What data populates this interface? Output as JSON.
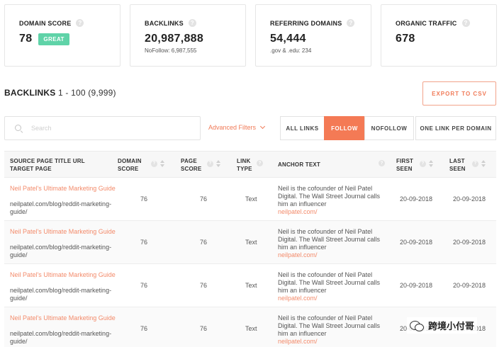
{
  "cards": [
    {
      "title": "DOMAIN SCORE",
      "value": "78",
      "badge": "GREAT",
      "sub": ""
    },
    {
      "title": "BACKLINKS",
      "value": "20,987,888",
      "badge": "",
      "sub": "NoFollow: 6,987,555"
    },
    {
      "title": "REFERRING DOMAINS",
      "value": "54,444",
      "badge": "",
      "sub": ".gov & .edu: 234"
    },
    {
      "title": "ORGANIC TRAFFIC",
      "value": "678",
      "badge": "",
      "sub": ""
    }
  ],
  "section": {
    "title": "BACKLINKS",
    "range": "1 - 100 (9,999)"
  },
  "export_label": "EXPORT TO CSV",
  "search": {
    "placeholder": "Search",
    "value": ""
  },
  "advanced_filters_label": "Advanced Filters",
  "filter_tabs": [
    {
      "label": "ALL LINKS",
      "active": false
    },
    {
      "label": "FOLLOW",
      "active": true
    },
    {
      "label": "NOFOLLOW",
      "active": false
    },
    {
      "label": "ONE LINK PER DOMAIN",
      "active": false
    }
  ],
  "table": {
    "columns": [
      {
        "key": "source",
        "label": "SOURCE PAGE TITLE URL\nTARGET PAGE"
      },
      {
        "key": "domain_score",
        "label": "DOMAIN\nSCORE"
      },
      {
        "key": "page_score",
        "label": "PAGE\nSCORE"
      },
      {
        "key": "link_type",
        "label": "LINK\nTYPE"
      },
      {
        "key": "anchor",
        "label": "ANCHOR TEXT"
      },
      {
        "key": "first_seen",
        "label": "FIRST\nSEEN"
      },
      {
        "key": "last_seen",
        "label": "LAST\nSEEN"
      }
    ],
    "rows": [
      {
        "title": "Neil Patel's Ultimate Marketing Guide",
        "url": "neilpatel.com/blog/reddit-marketing-guide/",
        "domain_score": "76",
        "page_score": "76",
        "link_type": "Text",
        "anchor": "Neil is the cofounder of Neil Patel Digital. The Wall Street Journal calls him an influencer",
        "anchor_link": "neilpatel.com/",
        "first_seen": "20-09-2018",
        "last_seen": "20-09-2018"
      },
      {
        "title": "Neil Patel's Ultimate Marketing Guide",
        "url": "neilpatel.com/blog/reddit-marketing-guide/",
        "domain_score": "76",
        "page_score": "76",
        "link_type": "Text",
        "anchor": "Neil is the cofounder of Neil Patel Digital. The Wall Street Journal calls him an influencer",
        "anchor_link": "neilpatel.com/",
        "first_seen": "20-09-2018",
        "last_seen": "20-09-2018"
      },
      {
        "title": "Neil Patel's Ultimate Marketing Guide",
        "url": "neilpatel.com/blog/reddit-marketing-guide/",
        "domain_score": "76",
        "page_score": "76",
        "link_type": "Text",
        "anchor": "Neil is the cofounder of Neil Patel Digital. The Wall Street Journal calls him an influencer",
        "anchor_link": "neilpatel.com/",
        "first_seen": "20-09-2018",
        "last_seen": "20-09-2018"
      },
      {
        "title": "Neil Patel's Ultimate Marketing Guide",
        "url": "neilpatel.com/blog/reddit-marketing-guide/",
        "domain_score": "76",
        "page_score": "76",
        "link_type": "Text",
        "anchor": "Neil is the cofounder of Neil Patel Digital. The Wall Street Journal calls him an influencer",
        "anchor_link": "neilpatel.com/",
        "first_seen": "20-09-2018",
        "last_seen": "20-09-2018"
      }
    ]
  },
  "watermark": "跨境小付哥",
  "colors": {
    "accent": "#f47a55",
    "badge": "#5fd3a8",
    "link": "#f38b6b"
  }
}
